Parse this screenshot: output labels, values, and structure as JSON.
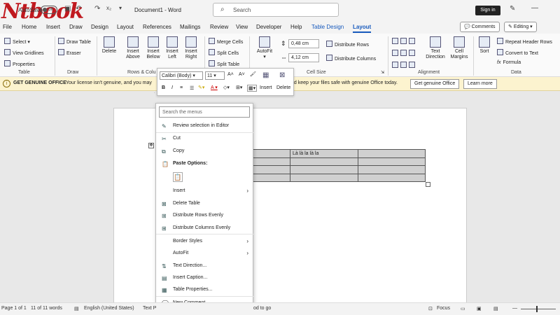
{
  "title_bar": {
    "logo": "Ntbook",
    "autosave_label": "AutoSave",
    "autosave_state": "Off",
    "doc_title": "Document1 - Word",
    "search_placeholder": "Search",
    "sign_in": "Sign in"
  },
  "tabs": {
    "file": "File",
    "home": "Home",
    "insert": "Insert",
    "draw": "Draw",
    "design": "Design",
    "layout": "Layout",
    "references": "References",
    "mailings": "Mailings",
    "review": "Review",
    "view": "View",
    "developer": "Developer",
    "help": "Help",
    "table_design": "Table Design",
    "table_layout": "Layout",
    "comments": "Comments",
    "editing": "Editing"
  },
  "ribbon": {
    "table": {
      "select": "Select",
      "view_gridlines": "View Gridlines",
      "properties": "Properties",
      "label": "Table"
    },
    "draw": {
      "draw_table": "Draw Table",
      "eraser": "Eraser",
      "label": "Draw"
    },
    "rows": {
      "delete": "Delete",
      "insert_above": "Insert Above",
      "insert_below": "Insert Below",
      "insert_left": "Insert Left",
      "insert_right": "Insert Right",
      "label": "Rows & Colu"
    },
    "merge": {
      "merge_cells": "Merge Cells",
      "split_cells": "Split Cells",
      "split_table": "Split Table"
    },
    "cell_size": {
      "autofit": "AutoFit",
      "height": "0,48 cm",
      "width": "4,12 cm",
      "distribute_rows": "Distribute Rows",
      "distribute_columns": "Distribute Columns",
      "label": "Cell Size"
    },
    "alignment": {
      "text_direction": "Text Direction",
      "cell_margins": "Cell Margins",
      "label": "Alignment"
    },
    "data": {
      "sort": "Sort",
      "repeat_header": "Repeat Header Rows",
      "convert": "Convert to Text",
      "formula": "Formula",
      "label": "Data"
    }
  },
  "notification": {
    "title": "GET GENUINE OFFICE",
    "message_left": "Your license isn't genuine, and you may",
    "message_right": "nd keep your files safe with genuine Office today.",
    "get_button": "Get genuine Office",
    "learn_button": "Learn more"
  },
  "ruler": {
    "text": "· 4 · · · · · · · · · · · · · 12 · · · 14 · · · 16"
  },
  "mini_toolbar": {
    "font": "Calibri (Body)",
    "size": "11",
    "bold": "B",
    "italic": "I",
    "insert": "Insert",
    "delete": "Delete"
  },
  "table": {
    "rows": [
      [
        "",
        "",
        "Là là la là la",
        ""
      ],
      [
        "",
        "",
        "",
        ""
      ],
      [
        "",
        "",
        "",
        ""
      ],
      [
        "",
        "",
        "",
        ""
      ]
    ]
  },
  "context_menu": {
    "search_placeholder": "Search the menus",
    "items": [
      "Review selection in Editor",
      "Cut",
      "Copy",
      "Paste Options:",
      "Insert",
      "Delete Table",
      "Distribute Rows Evenly",
      "Distribute Columns Evenly",
      "Border Styles",
      "AutoFit",
      "Text Direction...",
      "Insert Caption...",
      "Table Properties...",
      "New Comment"
    ]
  },
  "status_bar": {
    "page": "Page 1 of 1",
    "words": "11 of 11 words",
    "language": "English (United States)",
    "text_pred": "Text P",
    "accessibility": "od to go",
    "focus": "Focus"
  }
}
